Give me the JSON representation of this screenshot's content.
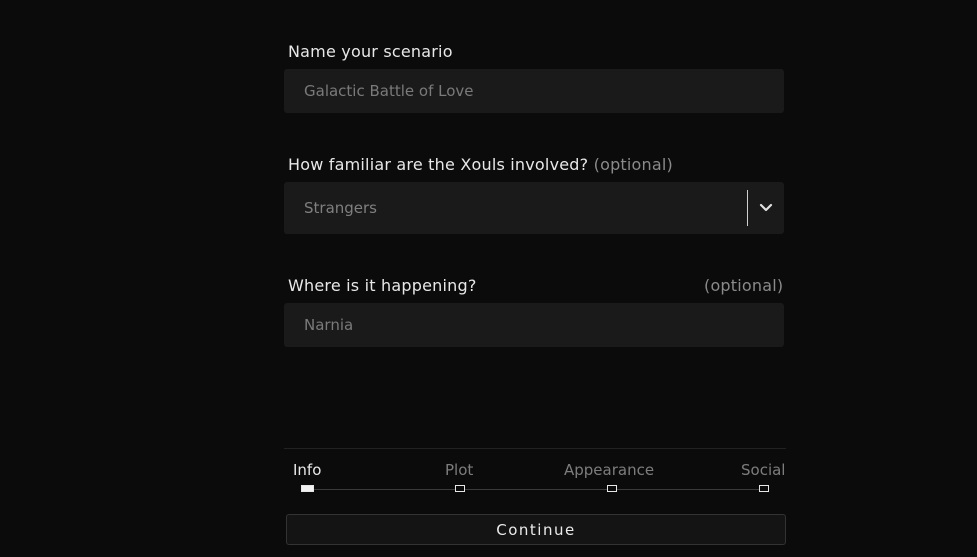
{
  "form": {
    "name": {
      "label": "Name your scenario",
      "placeholder": "Galactic Battle of Love"
    },
    "familiarity": {
      "label": "How familiar are the Xouls involved?",
      "optional": "(optional)",
      "selected": "Strangers"
    },
    "location": {
      "label": "Where is it happening?",
      "optional": "(optional)",
      "placeholder": "Narnia"
    }
  },
  "stepper": {
    "steps": [
      {
        "label": "Info",
        "active": true
      },
      {
        "label": "Plot",
        "active": false
      },
      {
        "label": "Appearance",
        "active": false
      },
      {
        "label": "Social",
        "active": false
      }
    ],
    "current_step": 1,
    "total_steps": 4
  },
  "continue_label": "Continue",
  "icons": {
    "select_arrow": "chevron-down-icon"
  }
}
